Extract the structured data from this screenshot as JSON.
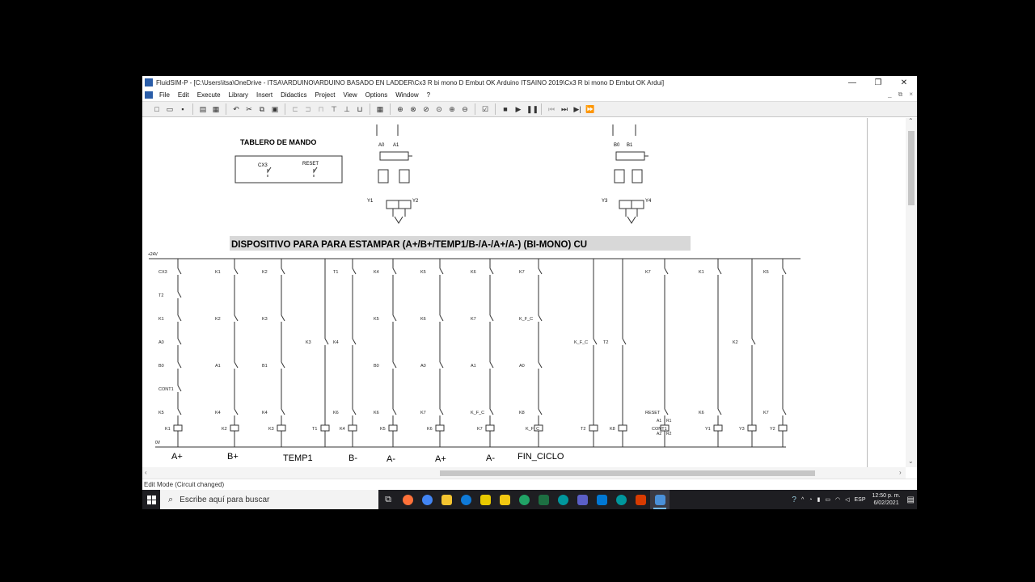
{
  "window": {
    "title": "FluidSIM-P - [C:\\Users\\itsa\\OneDrive - ITSA\\ARDUINO\\ARDUINO BASADO EN LADDER\\Cx3 R  bi mono D Embut OK Arduino ITSAINO 2019\\Cx3 R  bi mono D Embut OK Ardui]",
    "minimize": "—",
    "restore": "❐",
    "close": "✕"
  },
  "menu": {
    "items": [
      "File",
      "Edit",
      "Execute",
      "Library",
      "Insert",
      "Didactics",
      "Project",
      "View",
      "Options",
      "Window",
      "?"
    ],
    "child_controls": [
      "_",
      "⧉",
      "×"
    ]
  },
  "circuit": {
    "panel_title": "TABLERO  DE  MANDO",
    "panel_switches": [
      "CX3",
      "RESET"
    ],
    "cylinder_a": {
      "sensors": [
        "A0",
        "A1"
      ],
      "coils": [
        "Y1",
        "Y2"
      ]
    },
    "cylinder_b": {
      "sensors": [
        "B0",
        "B1"
      ],
      "coils": [
        "Y3",
        "Y4"
      ]
    },
    "banner": "DISPOSITIVO PARA PARA ESTAMPAR (A+/B+/TEMP1/B-/A-/A+/A-)   (BI-MONO)   CU",
    "supply_plus": "+24V",
    "supply_zero": "0V",
    "rungs": [
      {
        "coil": "K1",
        "contacts": [
          "CX3",
          "T2",
          "K1",
          "A0",
          "B0",
          "CONT1",
          "K5"
        ]
      },
      {
        "coil": "K2",
        "contacts": [
          "K1",
          "K2",
          "A1",
          "K4"
        ]
      },
      {
        "coil": "K3",
        "contacts": [
          "K2",
          "K3",
          "B1",
          "K4"
        ]
      },
      {
        "coil": "T1",
        "contacts": [
          "K3"
        ]
      },
      {
        "coil": "K4",
        "contacts": [
          "T1",
          "K4",
          "K6"
        ]
      },
      {
        "coil": "K5",
        "contacts": [
          "K4",
          "K5",
          "B0",
          "K6"
        ]
      },
      {
        "coil": "K6",
        "contacts": [
          "K5",
          "K6",
          "A0",
          "K7"
        ]
      },
      {
        "coil": "K7",
        "contacts": [
          "K6",
          "K7",
          "A1",
          "K_F_C"
        ]
      },
      {
        "coil": "K_F_C",
        "contacts": [
          "K7",
          "K_F_C",
          "A0",
          "K8"
        ]
      },
      {
        "coil": "T2",
        "contacts": [
          "K_F_C"
        ]
      },
      {
        "coil": "K8",
        "contacts": [
          "T2"
        ]
      },
      {
        "coil": "CONT1",
        "contacts": [
          "K7",
          "RESET"
        ],
        "terminals": [
          "A1",
          "R1",
          "A2",
          "R2"
        ]
      },
      {
        "coil": "Y1",
        "contacts": [
          "K1",
          "K6"
        ]
      },
      {
        "coil": "Y3",
        "contacts": [
          "K2"
        ]
      },
      {
        "coil": "Y2",
        "contacts": [
          "K5",
          "K7"
        ]
      }
    ],
    "step_labels": [
      "A+",
      "B+",
      "TEMP1",
      "B-",
      "A-",
      "A+",
      "A-",
      "FIN_CICLO"
    ]
  },
  "status": "Edit Mode (Circuit changed)",
  "taskbar": {
    "search_placeholder": "Escribe aquí para buscar",
    "language": "ESP",
    "time": "12:50 p. m.",
    "date": "6/02/2021",
    "app_colors": [
      "#ff7139",
      "#4285f4",
      "#f4c430",
      "#0f7ad8",
      "#e8c900",
      "#f2c811",
      "#21a366",
      "#1d6f42",
      "#00979d",
      "#5b5fc7",
      "#0078d4",
      "#00979d",
      "#d83b01",
      "#4a90d9"
    ]
  }
}
